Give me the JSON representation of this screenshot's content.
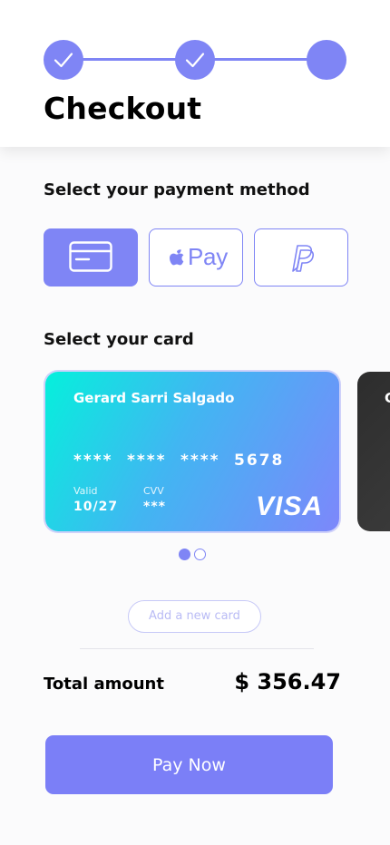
{
  "header": {
    "title": "Checkout",
    "steps": [
      {
        "state": "completed",
        "icon": "check-icon"
      },
      {
        "state": "completed",
        "icon": "check-icon"
      },
      {
        "state": "current"
      }
    ]
  },
  "payment_method": {
    "title": "Select your payment method",
    "options": [
      {
        "name": "credit-card",
        "icon": "credit-card-icon",
        "selected": true
      },
      {
        "name": "apple-pay",
        "icon": "apple-icon",
        "label": "Pay",
        "selected": false
      },
      {
        "name": "paypal",
        "icon": "paypal-icon",
        "selected": false
      }
    ]
  },
  "card_select": {
    "title": "Select your card",
    "cards": [
      {
        "holder": "Gerard Sarri Salgado",
        "number_groups": [
          "****",
          "****",
          "****",
          "5678"
        ],
        "valid_label": "Valid",
        "valid_value": "10/27",
        "cvv_label": "CVV",
        "cvv_value": "***",
        "brand": "VISA"
      },
      {
        "holder_initial": "G"
      }
    ],
    "pagination": {
      "current": 1,
      "total": 2
    },
    "add_card_label": "Add a new card"
  },
  "total": {
    "label": "Total amount",
    "value": "$ 356.47"
  },
  "pay_button_label": "Pay Now",
  "colors": {
    "accent": "#7f85f5",
    "button": "#7b7ff7",
    "card_gradient_start": "#05f0dc",
    "card_gradient_end": "#7d87fb",
    "dark_card": "#2d2d2d"
  }
}
